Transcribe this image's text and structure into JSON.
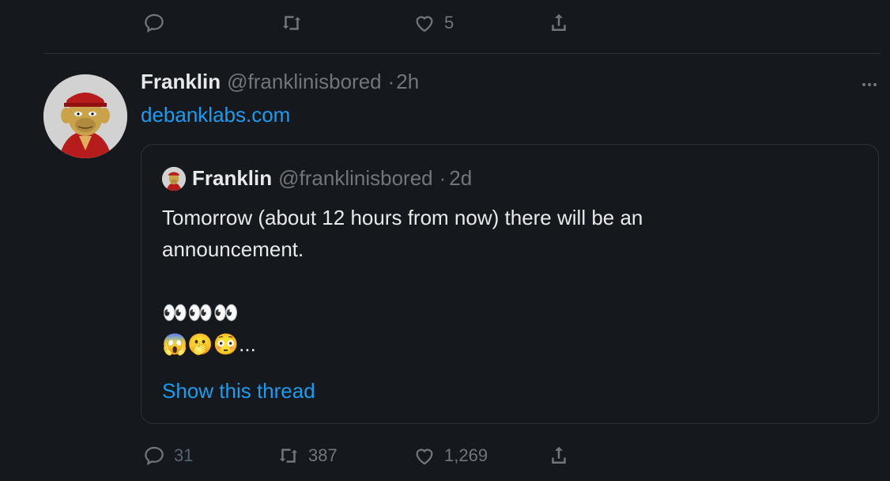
{
  "top_actions": {
    "reply_count": "",
    "retweet_count": "",
    "like_count": "5",
    "share_label": ""
  },
  "tweet": {
    "author_name": "Franklin",
    "author_handle": "@franklinisbored",
    "separator": "·",
    "time": "2h",
    "link_text": "debanklabs.com",
    "quote": {
      "author_name": "Franklin",
      "author_handle": "@franklinisbored",
      "separator": "·",
      "time": "2d",
      "text_line1": "Tomorrow (about 12 hours from now) there will be an",
      "text_line2": "announcement.",
      "emoji_line1": "👀👀👀",
      "emoji_line2": "😱🫢😳...",
      "show_thread": "Show this thread"
    },
    "actions": {
      "reply_count": "31",
      "retweet_count": "387",
      "like_count": "1,269"
    }
  },
  "colors": {
    "background": "#15181c",
    "text": "#e7e9ea",
    "muted": "#71767b",
    "link": "#1d9bf0",
    "border": "#2f3336"
  }
}
